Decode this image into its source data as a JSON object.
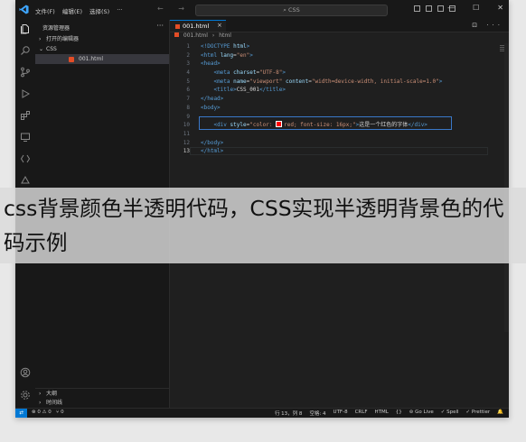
{
  "titlebar": {
    "menu": [
      "文件(F)",
      "编辑(E)",
      "选择(S)",
      "···"
    ],
    "nav_arrows": "← →",
    "search_text": "⌕ CSS",
    "window_controls": [
      "—",
      "☐",
      "✕"
    ]
  },
  "activity_bar": {
    "items": [
      "explorer-icon",
      "search-icon",
      "source-control-icon",
      "run-debug-icon",
      "extensions-icon",
      "remote-explorer-icon",
      "testing-icon",
      "live-share-icon"
    ],
    "bottom_items": [
      "account-icon",
      "manage-gear-icon"
    ]
  },
  "sidebar": {
    "header": "资源管理器",
    "more": "···",
    "open_editors": "打开的编辑器",
    "folder": "CSS",
    "file": "001.html",
    "outline": "大纲",
    "timeline": "时间线"
  },
  "editor": {
    "tab_label": "001.html",
    "tab_close": "×",
    "tab_actions": "⊡ ···",
    "breadcrumb": [
      "001.html",
      "›",
      "html"
    ],
    "lines": [
      {
        "n": "1",
        "html": "<span class='tag'>&lt;!DOCTYPE</span> <span class='attr'>html</span><span class='tag'>&gt;</span>"
      },
      {
        "n": "2",
        "html": "<span class='tag'>&lt;html</span> <span class='attr'>lang</span>=<span class='str'>\"en\"</span><span class='tag'>&gt;</span>"
      },
      {
        "n": "3",
        "html": "<span class='tag'>&lt;head&gt;</span>"
      },
      {
        "n": "4",
        "html": "    <span class='tag'>&lt;meta</span> <span class='attr'>charset</span>=<span class='str'>\"UTF-8\"</span><span class='tag'>&gt;</span>"
      },
      {
        "n": "5",
        "html": "    <span class='tag'>&lt;meta</span> <span class='attr'>name</span>=<span class='str'>\"viewport\"</span> <span class='attr'>content</span>=<span class='str'>\"width=device-width, initial-scale=1.0\"</span><span class='tag'>&gt;</span>"
      },
      {
        "n": "6",
        "html": "    <span class='tag'>&lt;title&gt;</span><span class='txt'>CSS_001</span><span class='tag'>&lt;/title&gt;</span>"
      },
      {
        "n": "7",
        "html": "<span class='tag'>&lt;/head&gt;</span>"
      },
      {
        "n": "8",
        "html": "<span class='tag'>&lt;body&gt;</span>"
      },
      {
        "n": "9",
        "html": ""
      },
      {
        "n": "10",
        "html": "    <span class='tag'>&lt;div</span> <span class='attr'>style</span>=<span class='str'>\"color: <span class='swatch'></span>red; font-size: 16px;\"</span><span class='tag'>&gt;</span><span class='txt'>这是一个红色的字体</span><span class='tag'>&lt;/div&gt;</span>"
      },
      {
        "n": "11",
        "html": ""
      },
      {
        "n": "12",
        "html": "<span class='tag'>&lt;/body&gt;</span>"
      },
      {
        "n": "13",
        "html": "<span class='tag'>&lt;/html&gt;</span>"
      }
    ]
  },
  "statusbar": {
    "remote": "⇄",
    "problems": "⊗ 0 ⚠ 0",
    "ports": "⑂ 0",
    "position": "行 13，列 8",
    "spaces": "空格: 4",
    "encoding": "UTF-8",
    "eol": "CRLF",
    "language": "HTML",
    "braces": "{}",
    "golive": "⊚ Go Live",
    "spell": "✓ Spell",
    "prettier": "✓ Prettier",
    "bell": "🔔"
  },
  "caption": "css背景颜色半透明代码，CSS实现半透明背景色的代码示例",
  "colors": {
    "accent": "#0078d4",
    "background": "#1f1f1f",
    "sidebar": "#181818"
  }
}
